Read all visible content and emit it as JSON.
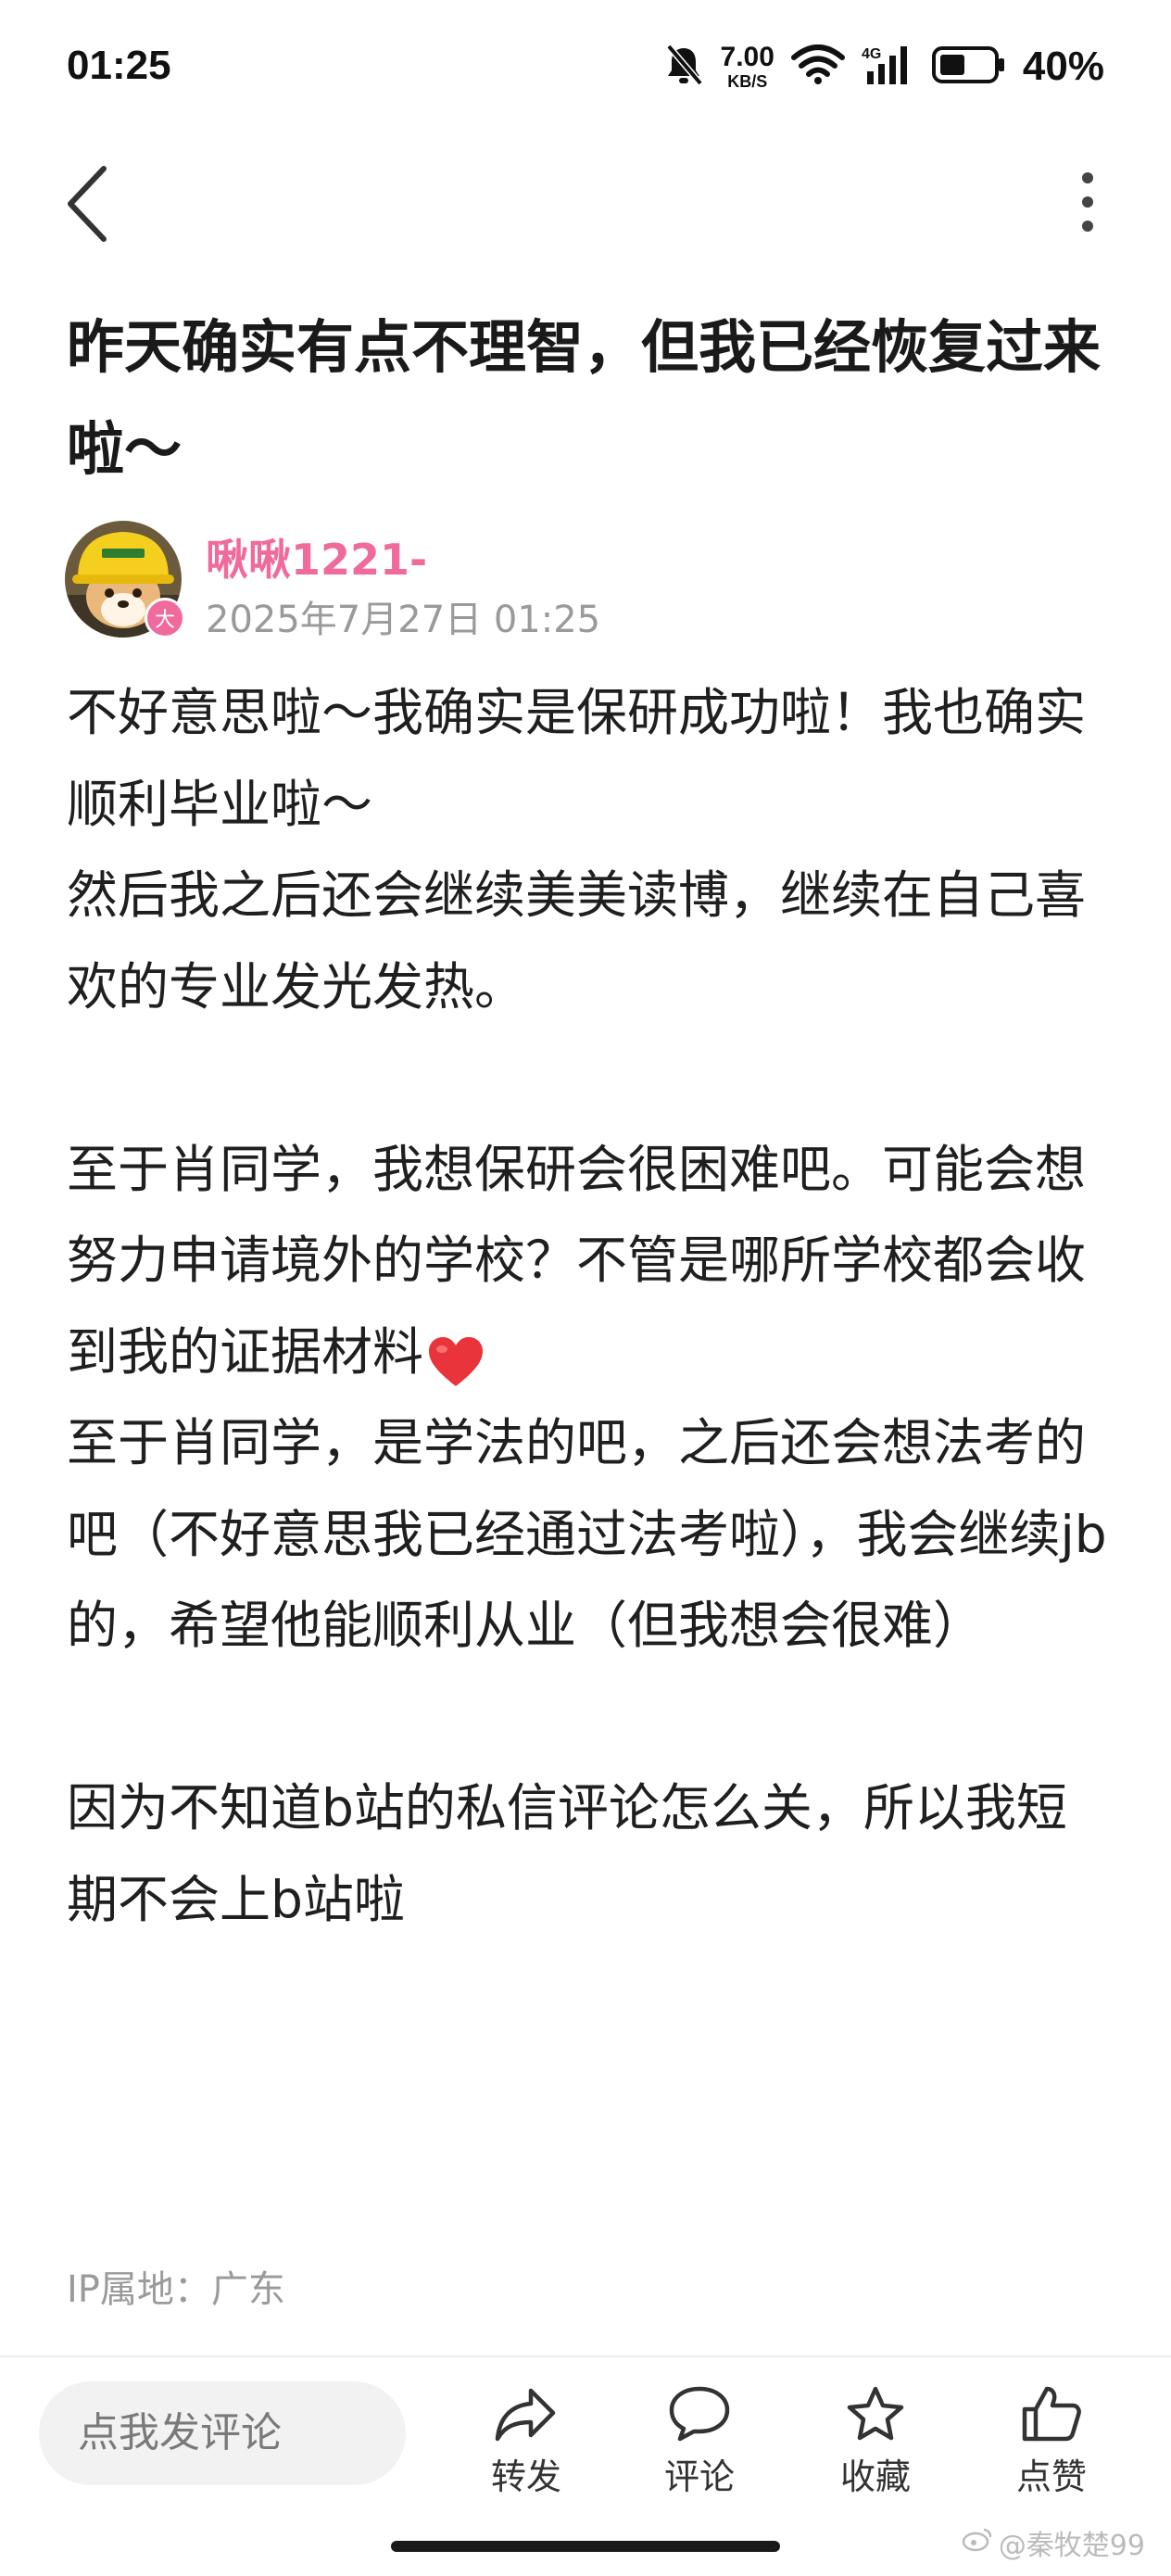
{
  "status_bar": {
    "time": "01:25",
    "net_speed_value": "7.00",
    "net_speed_unit": "KB/S",
    "network_type": "4G",
    "battery_percent": "40%",
    "icons": [
      "mute-bell-icon",
      "wifi-icon",
      "signal-4g-icon",
      "battery-icon"
    ]
  },
  "nav": {
    "back_icon": "chevron-left-icon",
    "more_icon": "vertical-dots-icon"
  },
  "post": {
    "title": "昨天确实有点不理智，但我已经恢复过来啦～",
    "author": {
      "name": "啾啾1221-",
      "badge": "大"
    },
    "date": "2025年7月27日 01:25",
    "body": [
      "不好意思啦～我确实是保研成功啦！我也确实顺利毕业啦～",
      "然后我之后还会继续美美读博，继续在自己喜欢的专业发光发热。",
      "",
      "至于肖同学，我想保研会很困难吧。可能会想努力申请境外的学校？不管是哪所学校都会收到我的证据材料",
      "至于肖同学，是学法的吧，之后还会想法考的吧（不好意思我已经通过法考啦），我会继续jb的，希望他能顺利从业（但我想会很难）",
      "",
      "因为不知道b站的私信评论怎么关，所以我短期不会上b站啦"
    ],
    "heart_emoji_color": "#e8343a",
    "ip_location": "IP属地：广东"
  },
  "bottom_bar": {
    "comment_placeholder": "点我发评论",
    "actions": [
      {
        "label": "转发",
        "icon": "share-arrow-icon"
      },
      {
        "label": "评论",
        "icon": "comment-bubble-icon"
      },
      {
        "label": "收藏",
        "icon": "star-icon"
      },
      {
        "label": "点赞",
        "icon": "thumbs-up-icon"
      }
    ]
  },
  "watermark": "@秦牧楚99",
  "colors": {
    "accent_pink": "#f06a9c",
    "muted_gray": "#9a9a9a"
  }
}
